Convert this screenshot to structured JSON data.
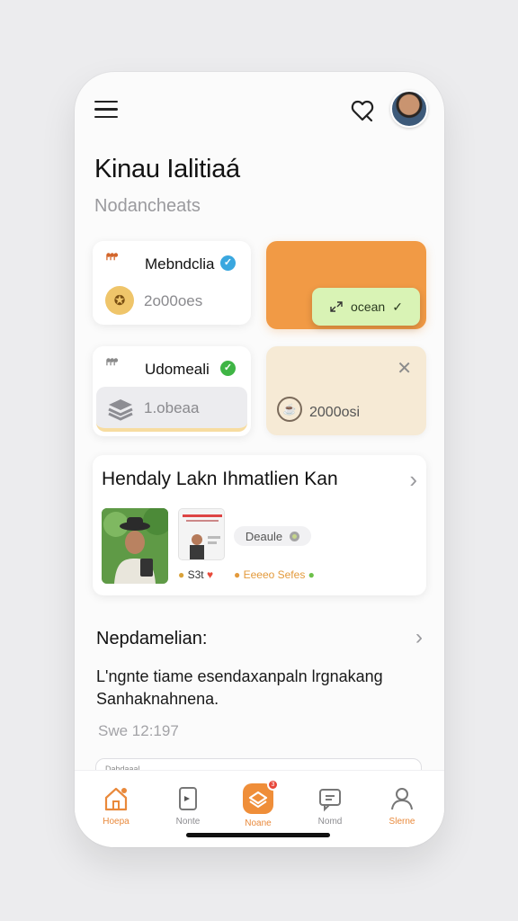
{
  "header": {
    "title": "Kinau Ialitiaá",
    "subtitle": "Nodancheats"
  },
  "cards": [
    {
      "logo": "ᖰᖰᖰ",
      "name": "Mebndclia",
      "value": "2o00oes",
      "verified_color": "#3aa7df"
    },
    {
      "logo": "ᖰᖰᖰ",
      "name": "Udomeali",
      "value": "1.obeaa",
      "verified_color": "#3fb545"
    },
    {
      "badge_label": "ocean",
      "accent": "#f19a45"
    },
    {
      "value": "2000osi"
    }
  ],
  "feature": {
    "title": "Hendaly Lakn Ihmatlien Kan",
    "pill_label": "Deaule",
    "meta_left": "S3t",
    "meta_right": "Eeeeo Sefes"
  },
  "section": {
    "title": "Nepdamelian:",
    "paragraph": "L'ngnte tiame esendaxanpaln lrgnakang Sanhaknahnena.",
    "timestamp": "Swe 12:197",
    "peek_label": "Dabdaaal"
  },
  "tabs": [
    {
      "label": "Hoepa",
      "icon": "home-icon",
      "active": true
    },
    {
      "label": "Nonte",
      "icon": "card-icon",
      "active": false
    },
    {
      "label": "Noane",
      "icon": "message-icon",
      "active": true,
      "badge": "3"
    },
    {
      "label": "Nomd",
      "icon": "chat-icon",
      "active": false
    },
    {
      "label": "Slerne",
      "icon": "profile-icon",
      "active": true
    }
  ]
}
